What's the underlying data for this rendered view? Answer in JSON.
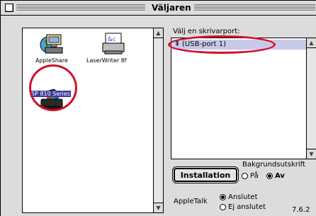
{
  "window": {
    "title": "Väljaren"
  },
  "devices": [
    {
      "label": "AppleShare",
      "icon": "appleshare-icon"
    },
    {
      "label": "LaserWriter 8f",
      "icon": "laserwriter-icon"
    },
    {
      "label": "SP 810 Series",
      "icon": "printer-icon",
      "selected": true
    }
  ],
  "ports": {
    "label": "Välj en skrivarport:",
    "items": [
      {
        "label": "(USB-port 1)",
        "icon": "usb-icon"
      }
    ]
  },
  "background_printing": {
    "label": "Bakgrundsutskrift",
    "options": [
      {
        "label": "På",
        "selected": false
      },
      {
        "label": "Av",
        "selected": true
      }
    ]
  },
  "install_button": "Installation",
  "appletalk": {
    "label": "AppleTalk",
    "options": [
      {
        "label": "Anslutet",
        "selected": true
      },
      {
        "label": "Ej anslutet",
        "selected": false
      }
    ]
  },
  "version": "7.6.2",
  "colors": {
    "annotation_red": "#d0102a",
    "selection_bg": "#3a3a9e"
  }
}
